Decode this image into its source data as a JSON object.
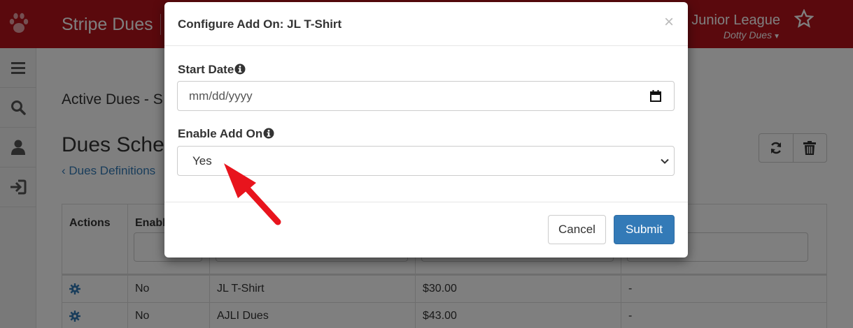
{
  "app": {
    "brand": "Stripe Dues",
    "org_name": "Junior League",
    "user_name": "Dotty Dues",
    "caret": "▼"
  },
  "page": {
    "section_title": "Active Dues - S",
    "heading": "Dues Schec",
    "back_link": "Dues Definitions"
  },
  "table": {
    "columns": [
      "Actions",
      "Enabl"
    ],
    "rows": [
      {
        "enabled": "No",
        "name": "JL T-Shirt",
        "price": "$30.00",
        "extra": "-"
      },
      {
        "enabled": "No",
        "name": "AJLI Dues",
        "price": "$43.00",
        "extra": "-"
      }
    ]
  },
  "modal": {
    "title": "Configure Add On: JL T-Shirt",
    "close": "×",
    "start_date_label": "Start Date",
    "start_date_placeholder": "mm/dd/yyyy",
    "enable_label": "Enable Add On",
    "enable_value": "Yes",
    "cancel_label": "Cancel",
    "submit_label": "Submit"
  },
  "colors": {
    "brand_red": "#b5121b",
    "primary_blue": "#337ab7",
    "annotation_arrow": "#e8141d"
  }
}
